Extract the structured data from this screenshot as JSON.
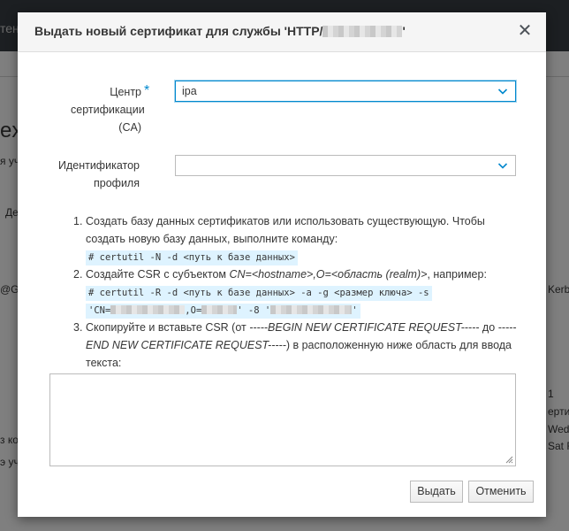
{
  "background": {
    "topbar_text": "тен",
    "title_fragment": "ex",
    "subtitle_fragment": "я уч",
    "button_fragment": "Де",
    "left_fragment": "@GG",
    "right_fragment_1": "Kerb",
    "right_fragment_2": "1",
    "right_fragment_3": "ертиф",
    "right_fragment_4": "Wed",
    "right_fragment_5": "Sat Fe",
    "left_fragment_2": "з ко",
    "left_fragment_3": "э уч"
  },
  "modal": {
    "title_prefix": "Выдать новый сертификат для службы 'HTTP/",
    "title_suffix": "'",
    "close_glyph": "✕",
    "ca_label_line1": "Центр",
    "ca_label_line2": "сертификации",
    "ca_label_line3": "(CA)",
    "required_mark": "*",
    "ca_value": "ipa",
    "profile_label_line1": "Идентификатор",
    "profile_label_line2": "профиля",
    "profile_value": "",
    "instructions": {
      "step1_num": "1.",
      "step1_text": "Создать базу данных сертификатов или использовать существующую. Чтобы создать новую базу данных, выполните команду:",
      "step1_code": "# certutil -N -d <путь к базе данных>",
      "step2_num": "2.",
      "step2_pre": "Создайте CSR с субъектом ",
      "step2_subject": "CN=<hostname>,O=<область (realm)>",
      "step2_post": ", например:",
      "step2_code1": "# certutil -R -d <путь к базе данных> -a -g <размер ключа> -s",
      "step2_code2_a": "'CN=",
      "step2_code2_b": ",O=",
      "step2_code2_c": "' -8 '",
      "step2_code2_d": "'",
      "step3_num": "3.",
      "step3_pre": "Скопируйте и вставьте CSR (от ",
      "step3_begin": "-----BEGIN NEW CERTIFICATE REQUEST-----",
      "step3_mid": " до ",
      "step3_end": "-----END NEW CERTIFICATE REQUEST-----",
      "step3_post": ") в расположенную ниже область для ввода текста:"
    },
    "csr_value": "",
    "issue_button": "Выдать",
    "cancel_button": "Отменить"
  },
  "colors": {
    "accent": "#0088ce",
    "code_bg": "#def3ff",
    "overlay": "rgba(0,0,0,0.5)"
  }
}
